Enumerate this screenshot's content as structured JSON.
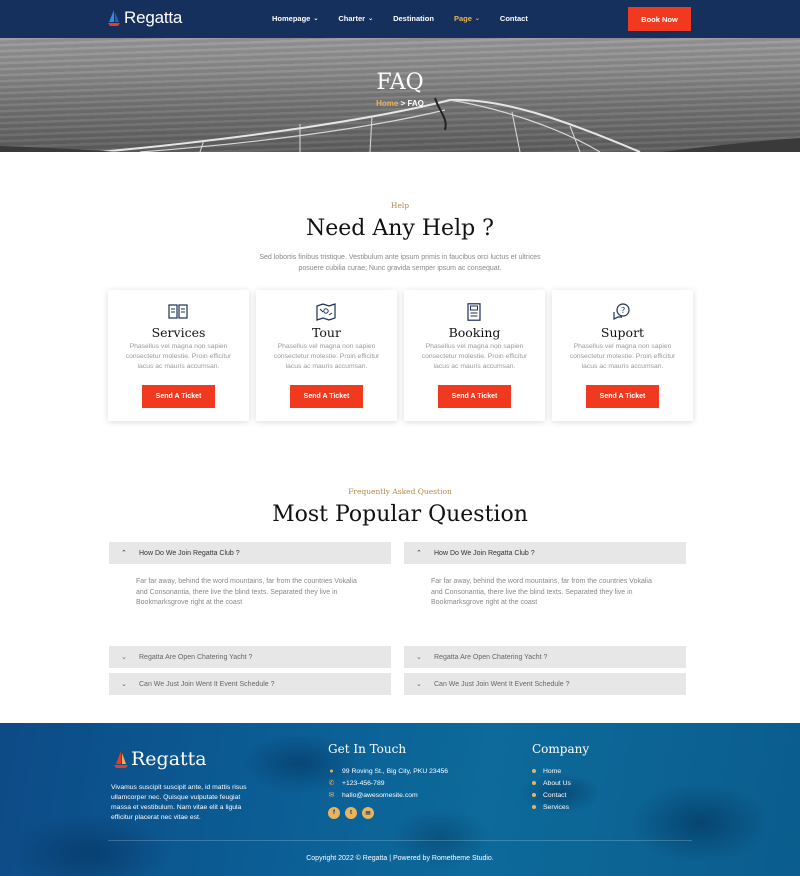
{
  "brand": {
    "name": "Regatta"
  },
  "nav": {
    "items": [
      {
        "label": "Homepage",
        "caret": "⌄"
      },
      {
        "label": "Charter",
        "caret": "⌄"
      },
      {
        "label": "Destination",
        "caret": ""
      },
      {
        "label": "Page",
        "caret": "⌄"
      },
      {
        "label": "Contact",
        "caret": ""
      }
    ],
    "active": "Page",
    "cta": "Book Now"
  },
  "hero": {
    "title": "FAQ",
    "breadcrumb": {
      "home": "Home",
      "separator": ">",
      "current": "FAQ"
    }
  },
  "help": {
    "eyebrow": "Help",
    "title": "Need Any Help ?",
    "subtitle": "Sed lobortis finibus tristique. Vestibulum ante ipsum primis in faucibus orci luctus et ultrices posuere cubilia curae; Nunc gravida semper ipsum ac consequat.",
    "cards": [
      {
        "icon": "book-icon",
        "title": "Services",
        "text": "Phasellus vel magna non sapien consectetur molestie. Proin efficitur lacus ac mauris accumsan.",
        "button": "Send A Ticket"
      },
      {
        "icon": "map-icon",
        "title": "Tour",
        "text": "Phasellus vel magna non sapien consectetur molestie. Proin efficitur lacus ac mauris accumsan.",
        "button": "Send A Ticket"
      },
      {
        "icon": "document-icon",
        "title": "Booking",
        "text": "Phasellus vel magna non sapien consectetur molestie. Proin efficitur lacus ac mauris accumsan.",
        "button": "Send A Ticket"
      },
      {
        "icon": "chat-question-icon",
        "title": "Suport",
        "text": "Phasellus vel magna non sapien consectetur molestie. Proin efficitur lacus ac mauris accumsan.",
        "button": "Send A Ticket"
      }
    ]
  },
  "faq": {
    "eyebrow": "Frequently Asked Question",
    "title": "Most Popular Question",
    "left": [
      {
        "q": "How Do We Join Regatta Club ?",
        "open": true,
        "a": "Far far away, behind the word mountains, far from the countries Vokalia and Consonantia, there live the blind texts. Separated they live in Bookmarksgrove right at the coast"
      },
      {
        "q": "Regatta Are Open Chatering Yacht ?",
        "open": false
      },
      {
        "q": "Can We Just Join Went It Event Schedule ?",
        "open": false
      }
    ],
    "right": [
      {
        "q": "How Do We Join Regatta Club ?",
        "open": true,
        "a": "Far far away, behind the word mountains, far from the countries Vokalia and Consonantia, there live the blind texts. Separated they live in Bookmarksgrove right at the coast"
      },
      {
        "q": "Regatta Are Open Chatering Yacht ?",
        "open": false
      },
      {
        "q": "Can We Just Join Went It Event Schedule ?",
        "open": false
      }
    ]
  },
  "footer": {
    "brand": "Regatta",
    "about": "Vivamus suscipit suscipit ante, id mattis risus ullamcorper nec. Quisque vulputate feugiat massa et vestibulum. Nam vitae elit a ligula efficitur placerat nec vitae est.",
    "contact_heading": "Get In Touch",
    "contact": {
      "address": "99 Roving St., Big City, PKU 23456",
      "phone": "+123-456-789",
      "email": "hallo@awesomesite.com"
    },
    "company_heading": "Company",
    "links": [
      "Home",
      "About Us",
      "Contact",
      "Services"
    ],
    "copyright": "Copyright 2022 © Regatta | Powered by Rometheme Studio."
  },
  "colors": {
    "navy": "#15305d",
    "accent": "#f0391e",
    "gold": "#e8b45d"
  }
}
